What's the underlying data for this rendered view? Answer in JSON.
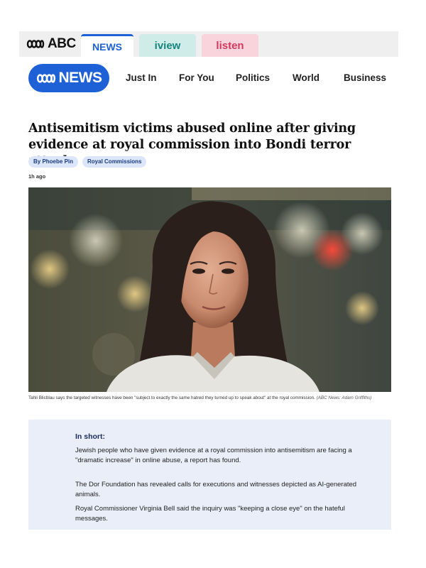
{
  "network": {
    "brand": "ABC",
    "tabs": [
      {
        "label": "NEWS",
        "active": true
      },
      {
        "label": "iview",
        "active": false
      },
      {
        "label": "listen",
        "active": false
      }
    ]
  },
  "news_nav": {
    "logo_text": "NEWS",
    "links": [
      "Just In",
      "For You",
      "Politics",
      "World",
      "Business"
    ]
  },
  "article": {
    "headline": "Antisemitism victims abused online after giving evidence at royal commission into Bondi terror attack",
    "tags": [
      "By Phoebe Pin",
      "Royal Commissions"
    ],
    "timestamp": "1h ago",
    "caption": "Tahli Blicblau says the targeted witnesses have been \"subject to exactly the same hatred they turned up to speak about\" at the royal commission.",
    "caption_credit": "(ABC News: Adam Griffiths)"
  },
  "in_short": {
    "title": "In short:",
    "points": [
      "Jewish people who have given evidence at a royal commission into antisemitism are facing a \"dramatic increase\" in online abuse, a report has found.",
      "The Dor Foundation has revealed calls for executions and witnesses depicted as AI-generated animals.",
      "Royal Commissioner Virginia Bell said the inquiry was \"keeping a close eye\" on the hateful messages."
    ]
  },
  "colors": {
    "abc_blue": "#1e61d6",
    "iview_teal": "#16857d",
    "listen_pink": "#d23a60",
    "tag_bg": "#dbe6fb",
    "short_box_bg": "#e9eef8"
  }
}
